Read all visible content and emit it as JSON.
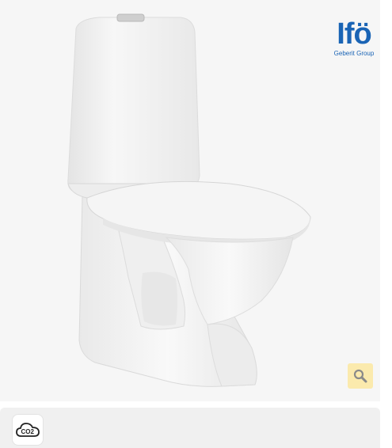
{
  "product_image": {
    "icon": "toilet-product-photo"
  },
  "brand": {
    "name": "Ifö",
    "subtitle": "Geberit Group",
    "color": "#1a64b5"
  },
  "zoom": {
    "icon": "magnifier-icon",
    "background": "#fbeaad"
  },
  "footer": {
    "badge_icon": "co2-cloud-icon",
    "badge_label": "CO2"
  }
}
